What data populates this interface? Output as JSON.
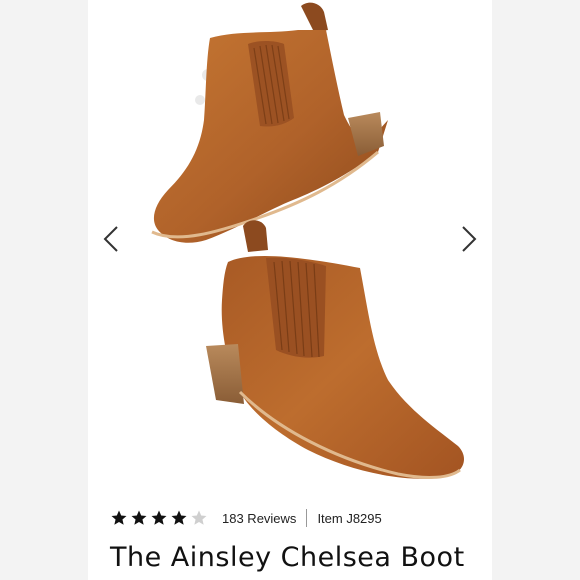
{
  "gallery": {
    "image_alt": "Tan leather Chelsea boots",
    "prev_icon": "chevron-left-icon",
    "next_icon": "chevron-right-icon",
    "arrow_color": "#333333"
  },
  "product": {
    "rating": 4,
    "rating_max": 5,
    "reviews_label": "183 Reviews",
    "item_label": "Item J8295",
    "title": "The Ainsley Chelsea Boot",
    "star_color": "#111111",
    "star_empty_color": "#cfcfcf",
    "leather_color": "#b8692c"
  }
}
